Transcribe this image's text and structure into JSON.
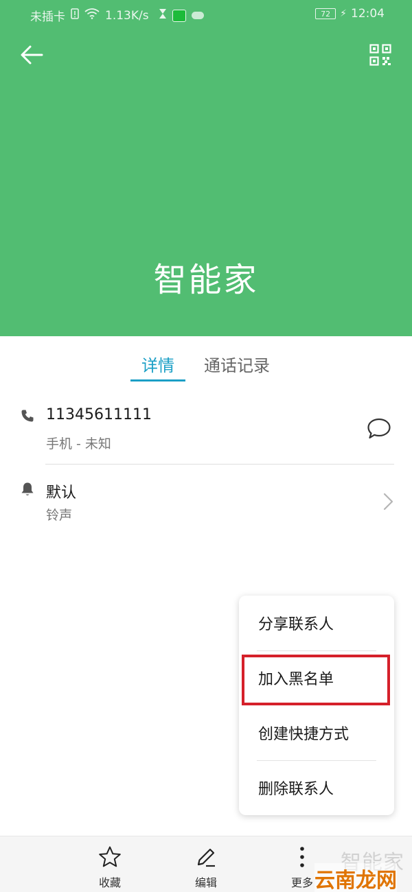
{
  "status_bar": {
    "carrier": "未插卡",
    "speed": "1.13K/s",
    "battery": "72",
    "time": "12:04"
  },
  "header": {
    "contact_name": "智能家",
    "background_color": "#52bd72"
  },
  "tabs": [
    {
      "label": "详情",
      "active": true
    },
    {
      "label": "通话记录",
      "active": false
    }
  ],
  "details": {
    "phone": {
      "number": "11345611111",
      "type": "手机 - 未知"
    },
    "ringtone": {
      "value": "默认",
      "label": "铃声"
    }
  },
  "menu": {
    "items": [
      "分享联系人",
      "加入黑名单",
      "创建快捷方式",
      "删除联系人"
    ],
    "highlighted_index": 1
  },
  "toolbar": {
    "favorite_label": "收藏",
    "edit_label": "编辑",
    "more_label": "更多"
  },
  "watermark": {
    "top_text": "智能家",
    "bottom_text": "云南龙网"
  },
  "colors": {
    "accent": "#1b9fc6",
    "highlight_border": "#d5202a"
  },
  "icons": {
    "back": "arrow-left-icon",
    "qr": "qr-code-icon",
    "phone": "phone-icon",
    "message": "message-bubble-icon",
    "bell": "bell-icon",
    "chevron": "chevron-right-icon",
    "star": "star-icon",
    "pencil": "pencil-icon",
    "more": "more-vertical-icon"
  }
}
